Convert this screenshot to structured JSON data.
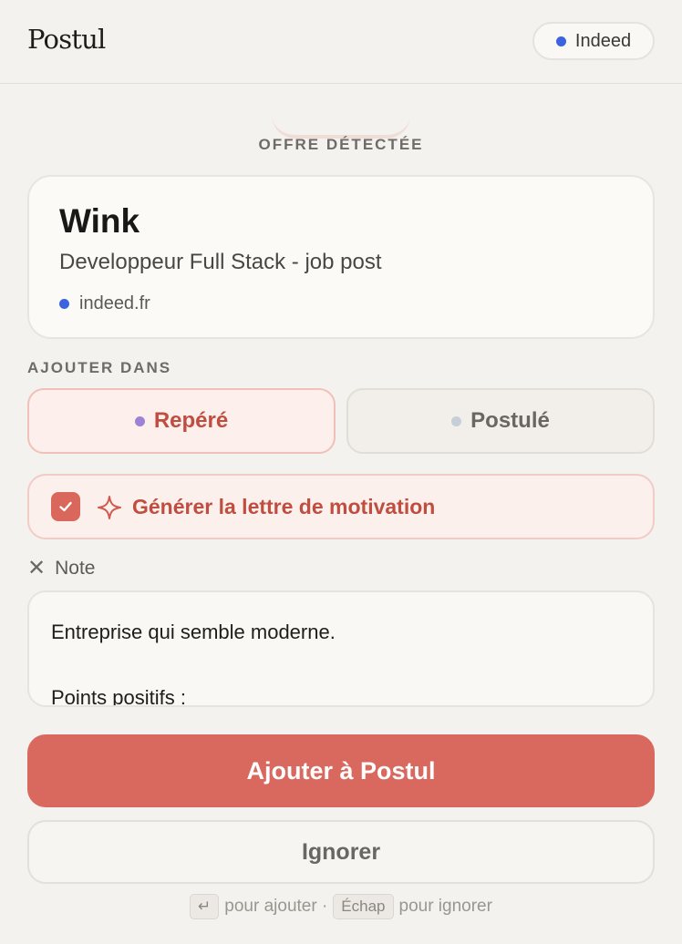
{
  "header": {
    "logo": "Postul",
    "source_label": "Indeed",
    "source_color": "#3b63e0"
  },
  "offer": {
    "section_title": "OFFRE DÉTECTÉE",
    "company": "Wink",
    "job_title": "Developpeur Full Stack - job post",
    "domain": "indeed.fr"
  },
  "add_to": {
    "section_title": "AJOUTER DANS",
    "options": [
      {
        "label": "Repéré",
        "selected": true,
        "dot_color": "#9b82d6"
      },
      {
        "label": "Postulé",
        "selected": false,
        "dot_color": "#c5ced9"
      }
    ]
  },
  "generate_letter": {
    "checked": true,
    "label": "Générer la lettre de motivation",
    "icon": "sparkle-icon"
  },
  "note": {
    "toggle_label": "Note",
    "text": "Entreprise qui semble moderne.\n\nPoints positifs :"
  },
  "actions": {
    "primary_label": "Ajouter à Postul",
    "secondary_label": "Ignorer"
  },
  "hint": {
    "enter_key": "↵",
    "enter_text": "pour ajouter ·",
    "escape_key": "Échap",
    "escape_text": "pour ignorer"
  },
  "colors": {
    "accent": "#d9695f",
    "accent_text": "#bf4d40",
    "background": "#f4f2ee"
  }
}
